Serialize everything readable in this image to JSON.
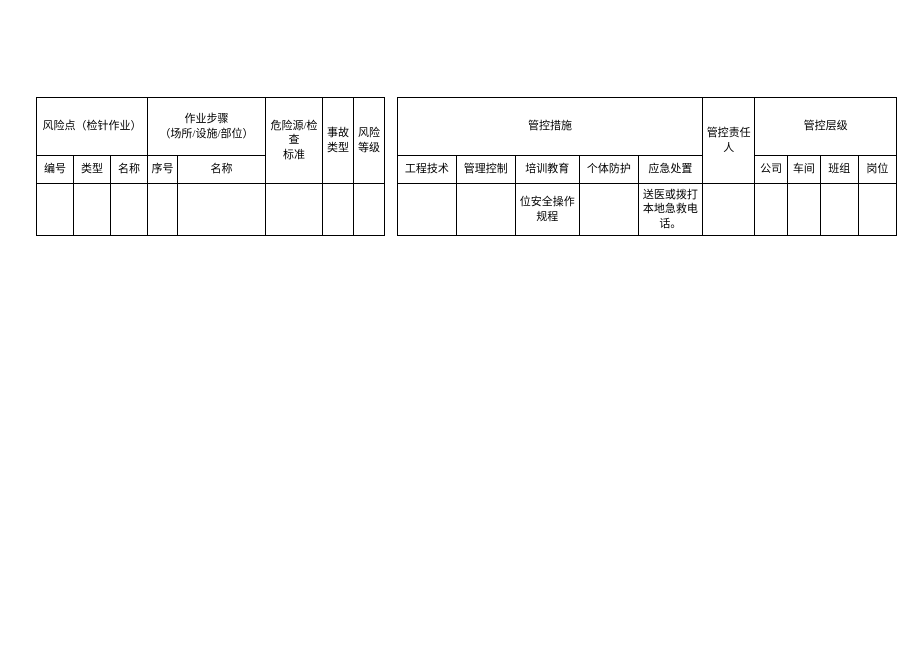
{
  "left": {
    "group_risk": "风险点（检针作业）",
    "group_step": "作业步骤\n（场所/设施/部位）",
    "col_hazard": "危险源/检查\n标准",
    "col_accident": "事故\n类型",
    "col_risklvl": "风险\n等级",
    "sub_no": "编号",
    "sub_type": "类型",
    "sub_name": "名称",
    "sub_seq": "序号",
    "sub_name2": "名称"
  },
  "right": {
    "group_measure": "管控措施",
    "col_owner": "管控责任人",
    "group_level": "管控层级",
    "sub_eng": "工程技术",
    "sub_mgmt": "管理控制",
    "sub_train": "培训教育",
    "sub_ppe": "个体防护",
    "sub_emerg": "应急处置",
    "sub_company": "公司",
    "sub_workshop": "车间",
    "sub_team": "班组",
    "sub_post": "岗位",
    "data_train": "位安全操作规程",
    "data_emerg": "送医或拨打本地急救电话。"
  }
}
